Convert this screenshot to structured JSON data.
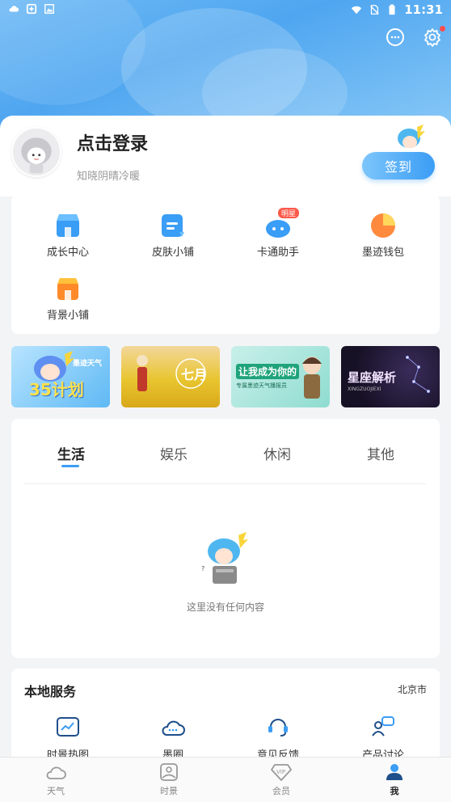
{
  "status_bar": {
    "time": "11:31"
  },
  "profile": {
    "login_title": "点击登录",
    "subtitle": "知晓阴晴冷暖",
    "signin_label": "签到"
  },
  "quick_grid": {
    "items": [
      {
        "label": "成长中心",
        "icon": "shop-growth-icon"
      },
      {
        "label": "皮肤小铺",
        "icon": "skin-shop-icon"
      },
      {
        "label": "卡通助手",
        "icon": "cartoon-assistant-icon",
        "badge": "明星"
      },
      {
        "label": "墨迹钱包",
        "icon": "wallet-icon"
      },
      {
        "label": "背景小铺",
        "icon": "background-shop-icon"
      }
    ]
  },
  "banners": [
    {
      "text": "35计划",
      "tag": "墨迹天气"
    },
    {
      "text": "七月"
    },
    {
      "text": "让我成为你的",
      "sub": "专属墨迹天气播报员"
    },
    {
      "text": "星座解析",
      "sub": "XINGZUOJIEXI"
    }
  ],
  "tabs": {
    "items": [
      "生活",
      "娱乐",
      "休闲",
      "其他"
    ],
    "active_index": 0,
    "empty_text": "这里没有任何内容"
  },
  "local_services": {
    "title": "本地服务",
    "city": "北京市",
    "items": [
      {
        "label": "时景热图",
        "icon": "heatmap-icon"
      },
      {
        "label": "墨圈",
        "icon": "cloud-circle-icon"
      },
      {
        "label": "意见反馈",
        "icon": "feedback-icon"
      },
      {
        "label": "产品讨论",
        "icon": "discussion-icon"
      }
    ]
  },
  "bottom_nav": {
    "items": [
      {
        "label": "天气",
        "icon": "cloud-icon"
      },
      {
        "label": "时景",
        "icon": "picture-icon"
      },
      {
        "label": "会员",
        "icon": "vip-icon"
      },
      {
        "label": "我",
        "icon": "user-icon"
      }
    ],
    "active_index": 3
  },
  "colors": {
    "accent": "#3b9df5",
    "hero_gradient_start": "#6fbaf5",
    "hero_gradient_end": "#8bcaf7",
    "badge_red": "#ff5a4a"
  }
}
